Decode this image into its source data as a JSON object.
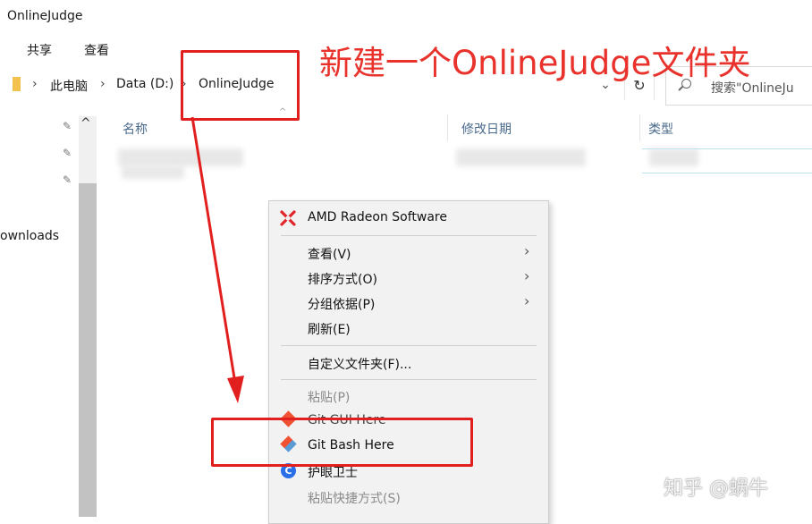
{
  "window": {
    "title": "OnlineJudge"
  },
  "ribbon": {
    "tabs": [
      "共享",
      "查看"
    ]
  },
  "address": {
    "segments": [
      "此电脑",
      "Data (D:)",
      "OnlineJudge"
    ],
    "search_placeholder": "搜索\"OnlineJu"
  },
  "nav": {
    "partial_label": "ownloads"
  },
  "columns": {
    "name": "名称",
    "date": "修改日期",
    "type": "类型"
  },
  "context_menu": {
    "items": [
      {
        "label": "AMD Radeon Software",
        "icon": "amd-radeon-icon",
        "enabled": true
      },
      {
        "label": "查看(V)",
        "submenu": true,
        "enabled": true
      },
      {
        "label": "排序方式(O)",
        "submenu": true,
        "enabled": true
      },
      {
        "label": "分组依据(P)",
        "submenu": true,
        "enabled": true
      },
      {
        "label": "刷新(E)",
        "enabled": true
      },
      {
        "label": "自定义文件夹(F)...",
        "enabled": true
      },
      {
        "label": "粘贴(P)",
        "enabled": false
      },
      {
        "label": "Git GUI Here",
        "icon": "git-gui-icon",
        "enabled": true
      },
      {
        "label": "Git Bash Here",
        "icon": "git-bash-icon",
        "enabled": true
      },
      {
        "label": "护眼卫士",
        "icon": "eye-guard-icon",
        "enabled": true
      },
      {
        "label": "粘贴快捷方式(S)",
        "enabled": false
      }
    ]
  },
  "annotation": {
    "text": "新建一个OnlineJudge文件夹",
    "color": "#e8322b"
  },
  "watermark": "知乎 @蜗牛"
}
